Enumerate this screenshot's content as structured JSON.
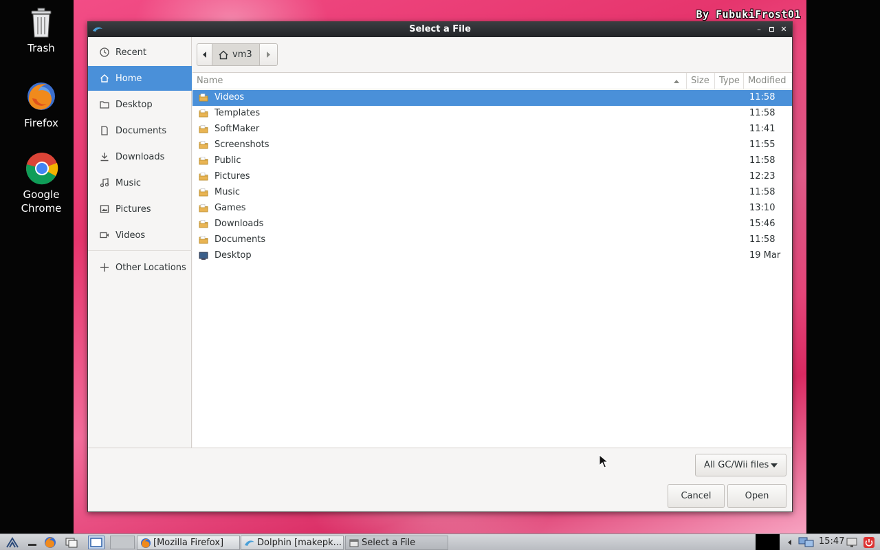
{
  "desktop": {
    "watermark": "By FubukiFrost01",
    "icons": [
      {
        "label": "Trash",
        "icon": "trash-icon"
      },
      {
        "label": "Firefox",
        "icon": "firefox-icon"
      },
      {
        "label": "Google Chrome",
        "icon": "chrome-icon"
      }
    ]
  },
  "dialog": {
    "title": "Select a File",
    "sidebar": [
      {
        "label": "Recent",
        "icon": "clock-icon"
      },
      {
        "label": "Home",
        "icon": "home-icon",
        "active": true
      },
      {
        "label": "Desktop",
        "icon": "folder-icon"
      },
      {
        "label": "Documents",
        "icon": "document-icon"
      },
      {
        "label": "Downloads",
        "icon": "download-icon"
      },
      {
        "label": "Music",
        "icon": "music-icon"
      },
      {
        "label": "Pictures",
        "icon": "picture-icon"
      },
      {
        "label": "Videos",
        "icon": "video-icon"
      },
      {
        "label": "Other Locations",
        "icon": "plus-icon"
      }
    ],
    "path": {
      "crumb": "vm3"
    },
    "columns": {
      "name": "Name",
      "size": "Size",
      "type": "Type",
      "modified": "Modified"
    },
    "files": [
      {
        "name": "Videos",
        "modified": "11:58",
        "selected": true
      },
      {
        "name": "Templates",
        "modified": "11:58"
      },
      {
        "name": "SoftMaker",
        "modified": "11:41"
      },
      {
        "name": "Screenshots",
        "modified": "11:55"
      },
      {
        "name": "Public",
        "modified": "11:58"
      },
      {
        "name": "Pictures",
        "modified": "12:23"
      },
      {
        "name": "Music",
        "modified": "11:58"
      },
      {
        "name": "Games",
        "modified": "13:10"
      },
      {
        "name": "Downloads",
        "modified": "15:46"
      },
      {
        "name": "Documents",
        "modified": "11:58"
      },
      {
        "name": "Desktop",
        "modified": "19 Mar"
      }
    ],
    "filter": "All GC/Wii files",
    "cancel_label": "Cancel",
    "open_label": "Open"
  },
  "taskbar": {
    "tasks": [
      {
        "label": "[Mozilla Firefox]",
        "icon": "firefox-icon"
      },
      {
        "label": "Dolphin [makepk...",
        "icon": "dolphin-icon"
      },
      {
        "label": "Select a File",
        "icon": "window-icon"
      }
    ],
    "clock": "15:47"
  },
  "colors": {
    "accent": "#4a90d9",
    "wallpaper": "#e6356d"
  }
}
